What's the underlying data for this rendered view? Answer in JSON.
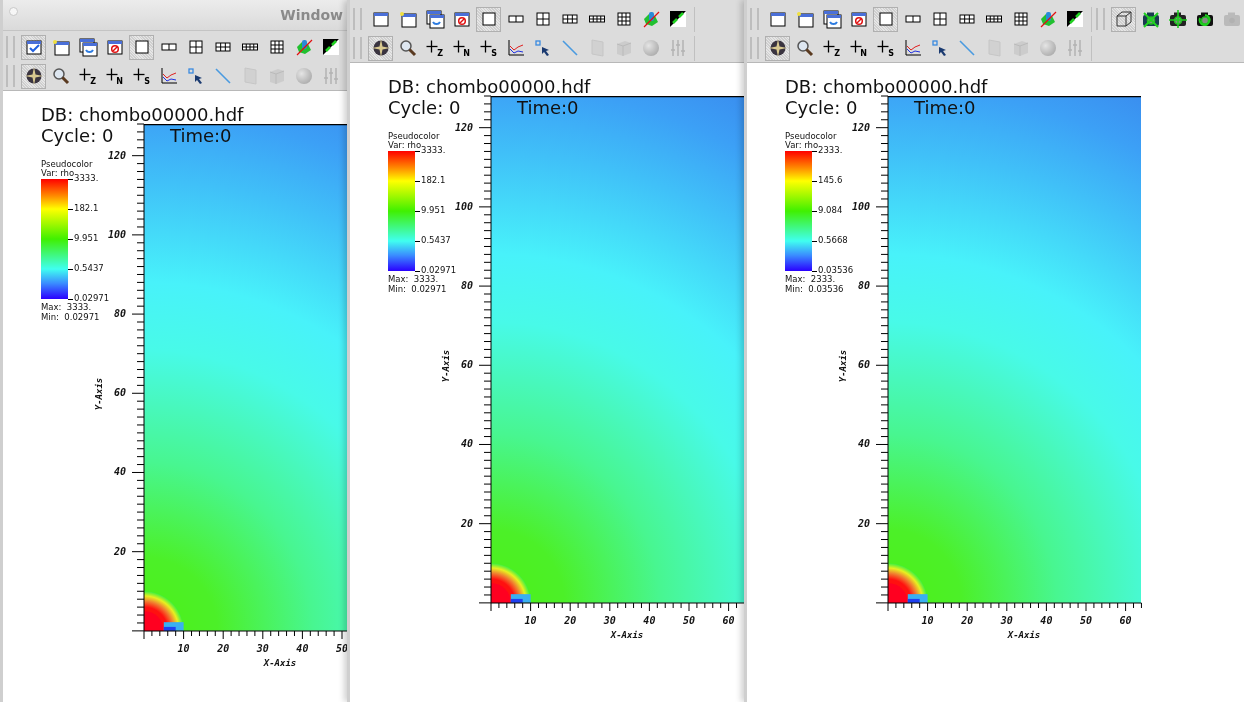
{
  "windows": [
    {
      "title": "Window",
      "toolbars": [
        {
          "groups": [
            {
              "items": [
                {
                  "kind": "active-window",
                  "selected": true,
                  "disabled": false
                },
                {
                  "kind": "new-window",
                  "selected": false,
                  "disabled": false
                },
                {
                  "kind": "clone-window",
                  "selected": false,
                  "disabled": false
                },
                {
                  "kind": "delete-window",
                  "selected": false,
                  "disabled": false
                },
                {
                  "kind": "layout-1x1",
                  "selected": true,
                  "disabled": false
                },
                {
                  "kind": "layout-1x2",
                  "selected": false,
                  "disabled": false
                },
                {
                  "kind": "layout-2x2",
                  "selected": false,
                  "disabled": false
                },
                {
                  "kind": "layout-2x3",
                  "selected": false,
                  "disabled": false
                },
                {
                  "kind": "layout-2x4",
                  "selected": false,
                  "disabled": false
                },
                {
                  "kind": "layout-3x3",
                  "selected": false,
                  "disabled": false
                },
                {
                  "kind": "spin-lock",
                  "selected": false,
                  "disabled": false
                },
                {
                  "kind": "invert",
                  "selected": false,
                  "disabled": false
                }
              ]
            }
          ]
        },
        {
          "groups": [
            {
              "items": [
                {
                  "kind": "navigate",
                  "selected": true,
                  "disabled": false
                },
                {
                  "kind": "zoom",
                  "selected": false,
                  "disabled": false
                },
                {
                  "kind": "pick",
                  "label": "Z",
                  "selected": false,
                  "disabled": false
                },
                {
                  "kind": "pick",
                  "label": "N",
                  "selected": false,
                  "disabled": false
                },
                {
                  "kind": "pick",
                  "label": "S",
                  "selected": false,
                  "disabled": false
                },
                {
                  "kind": "curve",
                  "selected": false,
                  "disabled": false
                },
                {
                  "kind": "point-tool",
                  "selected": false,
                  "disabled": false
                },
                {
                  "kind": "line",
                  "selected": false,
                  "disabled": false
                },
                {
                  "kind": "plane",
                  "selected": false,
                  "disabled": true
                },
                {
                  "kind": "box",
                  "selected": false,
                  "disabled": true
                },
                {
                  "kind": "sphere",
                  "selected": false,
                  "disabled": true
                },
                {
                  "kind": "sliders",
                  "selected": false,
                  "disabled": true
                }
              ]
            }
          ]
        }
      ],
      "canvas": {
        "database": "DB: chombo00000.hdf",
        "cycle": "Cycle: 0",
        "time": "Time:0",
        "legend": {
          "title": "Pseudocolor",
          "variable": "Var: rho",
          "labels": [
            "3333.",
            "182.1",
            "9.951",
            "0.5437",
            "0.02971"
          ],
          "max": "Max:  3333.",
          "min": "Min:  0.02971"
        },
        "axes": {
          "xlabel": "X-Axis",
          "ylabel": "Y-Axis",
          "xticks": [
            "10",
            "20",
            "30",
            "40",
            "50"
          ],
          "yticks": [
            "120",
            "100",
            "80",
            "60",
            "40",
            "20"
          ]
        }
      }
    },
    {
      "toolbars": [
        {
          "groups": [
            {
              "items": [
                {
                  "kind": "window",
                  "selected": false,
                  "disabled": false
                },
                {
                  "kind": "new-window",
                  "selected": false,
                  "disabled": false
                },
                {
                  "kind": "clone-window",
                  "selected": false,
                  "disabled": false
                },
                {
                  "kind": "delete-window",
                  "selected": false,
                  "disabled": false
                },
                {
                  "kind": "layout-1x1",
                  "selected": true,
                  "disabled": false
                },
                {
                  "kind": "layout-1x2",
                  "selected": false,
                  "disabled": false
                },
                {
                  "kind": "layout-2x2",
                  "selected": false,
                  "disabled": false
                },
                {
                  "kind": "layout-2x3",
                  "selected": false,
                  "disabled": false
                },
                {
                  "kind": "layout-2x4",
                  "selected": false,
                  "disabled": false
                },
                {
                  "kind": "layout-3x3",
                  "selected": false,
                  "disabled": false
                },
                {
                  "kind": "spin-lock",
                  "selected": false,
                  "disabled": false
                },
                {
                  "kind": "invert",
                  "selected": false,
                  "disabled": false
                }
              ]
            }
          ]
        },
        {
          "groups": [
            {
              "items": [
                {
                  "kind": "navigate",
                  "selected": true,
                  "disabled": false
                },
                {
                  "kind": "zoom",
                  "selected": false,
                  "disabled": false
                },
                {
                  "kind": "pick",
                  "label": "Z",
                  "selected": false,
                  "disabled": false
                },
                {
                  "kind": "pick",
                  "label": "N",
                  "selected": false,
                  "disabled": false
                },
                {
                  "kind": "pick",
                  "label": "S",
                  "selected": false,
                  "disabled": false
                },
                {
                  "kind": "curve",
                  "selected": false,
                  "disabled": false
                },
                {
                  "kind": "point-tool",
                  "selected": false,
                  "disabled": false
                },
                {
                  "kind": "line",
                  "selected": false,
                  "disabled": false
                },
                {
                  "kind": "plane",
                  "selected": false,
                  "disabled": true
                },
                {
                  "kind": "box",
                  "selected": false,
                  "disabled": true
                },
                {
                  "kind": "sphere",
                  "selected": false,
                  "disabled": true
                },
                {
                  "kind": "sliders",
                  "selected": false,
                  "disabled": true
                }
              ]
            }
          ]
        }
      ],
      "canvas": {
        "database": "DB: chombo00000.hdf",
        "cycle": "Cycle: 0",
        "time": "Time:0",
        "legend": {
          "title": "Pseudocolor",
          "variable": "Var: rho",
          "labels": [
            "3333.",
            "182.1",
            "9.951",
            "0.5437",
            "0.02971"
          ],
          "max": "Max:  3333.",
          "min": "Min:  0.02971"
        },
        "axes": {
          "xlabel": "X-Axis",
          "ylabel": "Y-Axis",
          "xticks": [
            "10",
            "20",
            "30",
            "40",
            "50",
            "60"
          ],
          "yticks": [
            "120",
            "100",
            "80",
            "60",
            "40",
            "20"
          ]
        }
      }
    },
    {
      "toolbars": [
        {
          "groups": [
            {
              "items": [
                {
                  "kind": "window",
                  "selected": false,
                  "disabled": false
                },
                {
                  "kind": "new-window",
                  "selected": false,
                  "disabled": false
                },
                {
                  "kind": "clone-window",
                  "selected": false,
                  "disabled": false
                },
                {
                  "kind": "delete-window",
                  "selected": false,
                  "disabled": false
                },
                {
                  "kind": "layout-1x1",
                  "selected": true,
                  "disabled": false
                },
                {
                  "kind": "layout-1x2",
                  "selected": false,
                  "disabled": false
                },
                {
                  "kind": "layout-2x2",
                  "selected": false,
                  "disabled": false
                },
                {
                  "kind": "layout-2x3",
                  "selected": false,
                  "disabled": false
                },
                {
                  "kind": "layout-2x4",
                  "selected": false,
                  "disabled": false
                },
                {
                  "kind": "layout-3x3",
                  "selected": false,
                  "disabled": false
                },
                {
                  "kind": "spin-lock",
                  "selected": false,
                  "disabled": false
                },
                {
                  "kind": "invert",
                  "selected": false,
                  "disabled": false
                }
              ]
            },
            {
              "items": [
                {
                  "kind": "cube",
                  "selected": true,
                  "disabled": false
                },
                {
                  "kind": "camera-reset",
                  "selected": false,
                  "disabled": false
                },
                {
                  "kind": "camera-move",
                  "selected": false,
                  "disabled": false
                },
                {
                  "kind": "camera-undo",
                  "selected": false,
                  "disabled": false
                },
                {
                  "kind": "camera",
                  "selected": false,
                  "disabled": true
                }
              ]
            }
          ]
        },
        {
          "groups": [
            {
              "items": [
                {
                  "kind": "navigate",
                  "selected": true,
                  "disabled": false
                },
                {
                  "kind": "zoom",
                  "selected": false,
                  "disabled": false
                },
                {
                  "kind": "pick",
                  "label": "Z",
                  "selected": false,
                  "disabled": false
                },
                {
                  "kind": "pick",
                  "label": "N",
                  "selected": false,
                  "disabled": false
                },
                {
                  "kind": "pick",
                  "label": "S",
                  "selected": false,
                  "disabled": false
                },
                {
                  "kind": "curve",
                  "selected": false,
                  "disabled": false
                },
                {
                  "kind": "point-tool",
                  "selected": false,
                  "disabled": false
                },
                {
                  "kind": "line",
                  "selected": false,
                  "disabled": false
                },
                {
                  "kind": "plane",
                  "selected": false,
                  "disabled": true
                },
                {
                  "kind": "box",
                  "selected": false,
                  "disabled": true
                },
                {
                  "kind": "sphere",
                  "selected": false,
                  "disabled": true
                },
                {
                  "kind": "sliders",
                  "selected": false,
                  "disabled": true
                }
              ]
            }
          ]
        }
      ],
      "canvas": {
        "database": "DB: chombo00000.hdf",
        "cycle": "Cycle: 0",
        "time": "Time:0",
        "legend": {
          "title": "Pseudocolor",
          "variable": "Var: rho",
          "labels": [
            "2333.",
            "145.6",
            "9.084",
            "0.5668",
            "0.03536"
          ],
          "max": "Max:  2333.",
          "min": "Min:  0.03536"
        },
        "axes": {
          "xlabel": "X-Axis",
          "ylabel": "Y-Axis",
          "xticks": [
            "10",
            "20",
            "30",
            "40",
            "50",
            "60"
          ],
          "yticks": [
            "120",
            "100",
            "80",
            "60",
            "40",
            "20"
          ]
        }
      }
    }
  ]
}
